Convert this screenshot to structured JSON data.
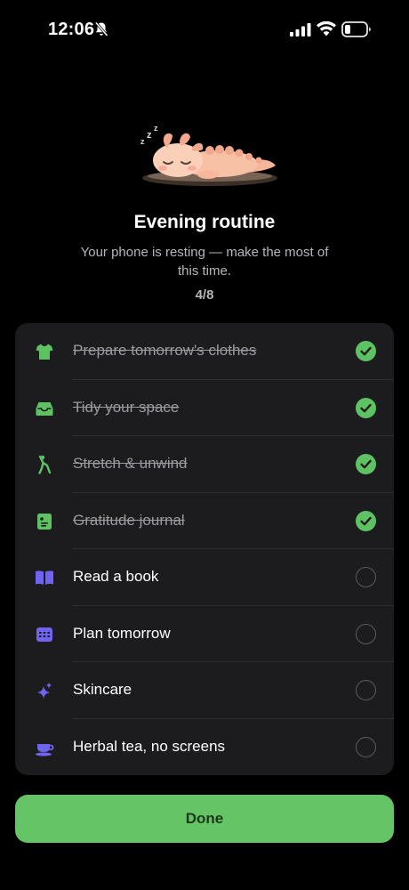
{
  "status_bar": {
    "time": "12:06",
    "icons": [
      "bell-slash-icon",
      "cellular-signal-icon",
      "wifi-icon",
      "battery-icon"
    ]
  },
  "hero": {
    "mascot": "sleeping-axolotl-illustration",
    "title": "Evening routine",
    "subtitle": "Your phone is resting — make the most of this time.",
    "progress": "4/8"
  },
  "colors": {
    "background": "#000000",
    "card": "#1c1c1e",
    "accent_green": "#65c466",
    "accent_purple": "#6f63f0",
    "done_text": "#9a9aa0"
  },
  "tasks": [
    {
      "label": "Prepare tomorrow's clothes",
      "icon": "tshirt-icon",
      "done": true
    },
    {
      "label": "Tidy your space",
      "icon": "tray-icon",
      "done": true
    },
    {
      "label": "Stretch & unwind",
      "icon": "stretch-figure-icon",
      "done": true
    },
    {
      "label": "Gratitude journal",
      "icon": "journal-icon",
      "done": true
    },
    {
      "label": "Read a book",
      "icon": "book-icon",
      "done": false
    },
    {
      "label": "Plan tomorrow",
      "icon": "calendar-icon",
      "done": false
    },
    {
      "label": "Skincare",
      "icon": "sparkles-icon",
      "done": false
    },
    {
      "label": "Herbal tea, no screens",
      "icon": "tea-cup-icon",
      "done": false
    }
  ],
  "footer": {
    "done_label": "Done"
  }
}
